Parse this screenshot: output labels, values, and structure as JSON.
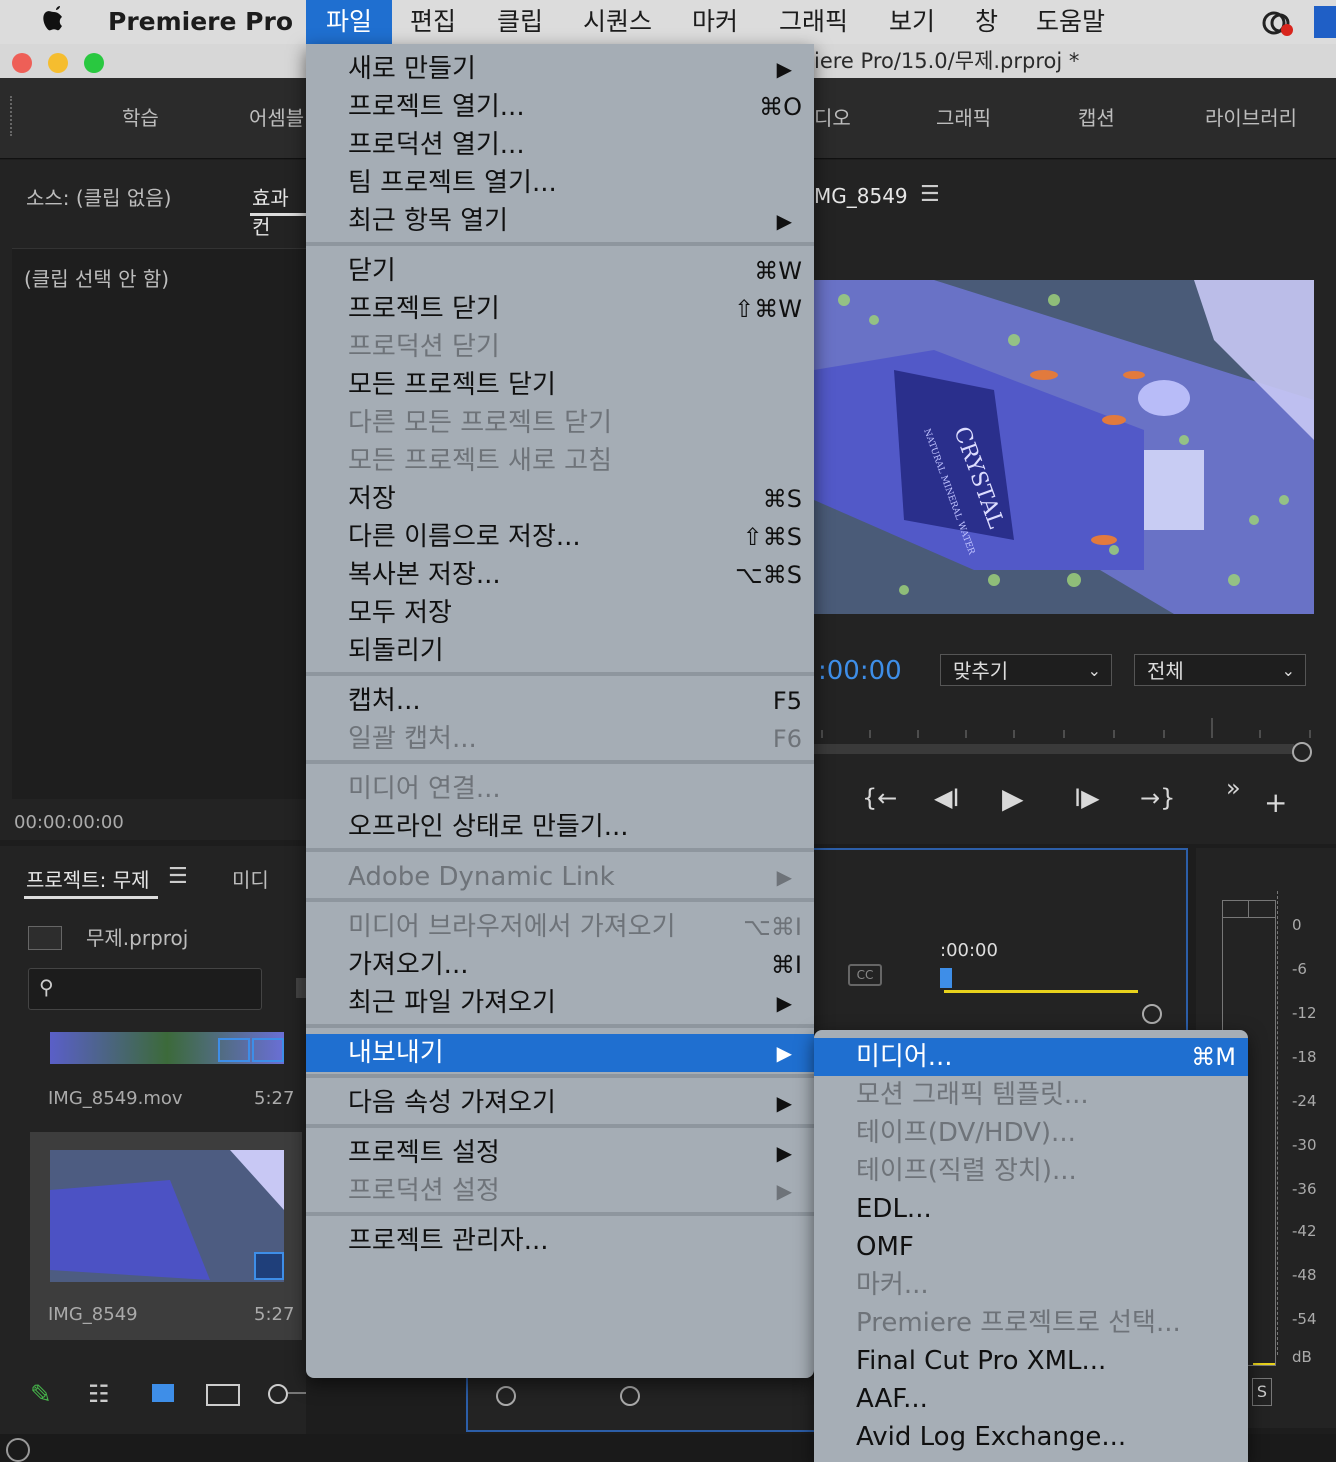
{
  "menubar": {
    "app_name": "Premiere Pro",
    "items": [
      "파일",
      "편집",
      "클립",
      "시퀀스",
      "마커",
      "그래픽",
      "보기",
      "창",
      "도움말"
    ]
  },
  "window": {
    "title": "iere Pro/15.0/무제.prproj *"
  },
  "workspaces": [
    "학습",
    "어셈블",
    "디오",
    "그래픽",
    "캡션",
    "라이브러리"
  ],
  "source_panel": {
    "tab_source": "소스: (클립 없음)",
    "tab_effects": "효과 컨",
    "no_clip": "(클립 선택 안 함)",
    "timecode": "00:00:00:00"
  },
  "program_monitor": {
    "sequence": "MG_8549",
    "timecode": ":00:00",
    "fit": "맞추기",
    "quality": "전체"
  },
  "project_panel": {
    "tab_project": "프로젝트: 무제",
    "tab_media": "미디",
    "file": "무제.prproj",
    "items": [
      {
        "name": "IMG_8549.mov",
        "duration": "5:27"
      },
      {
        "name": "IMG_8549",
        "duration": "5:27"
      }
    ]
  },
  "timeline": {
    "timecode": ":00:00"
  },
  "audio_meter": {
    "labels": [
      "0",
      "-6",
      "-12",
      "-18",
      "-24",
      "-30",
      "-36",
      "-42",
      "-48",
      "-54",
      "dB"
    ],
    "solo": "S"
  },
  "video_text": {
    "brand": "CRYSTAL",
    "sub": "NATURAL MINERAL WATER"
  },
  "file_menu": {
    "groups": [
      [
        {
          "label": "새로 만들기",
          "shortcut": "",
          "submenu": true,
          "disabled": false
        },
        {
          "label": "프로젝트 열기...",
          "shortcut": "⌘O",
          "submenu": false,
          "disabled": false
        },
        {
          "label": "프로덕션 열기...",
          "shortcut": "",
          "submenu": false,
          "disabled": false
        },
        {
          "label": "팀 프로젝트 열기...",
          "shortcut": "",
          "submenu": false,
          "disabled": false
        },
        {
          "label": "최근 항목 열기",
          "shortcut": "",
          "submenu": true,
          "disabled": false
        }
      ],
      [
        {
          "label": "닫기",
          "shortcut": "⌘W",
          "submenu": false,
          "disabled": false
        },
        {
          "label": "프로젝트 닫기",
          "shortcut": "⇧⌘W",
          "submenu": false,
          "disabled": false
        },
        {
          "label": "프로덕션 닫기",
          "shortcut": "",
          "submenu": false,
          "disabled": true
        },
        {
          "label": "모든 프로젝트 닫기",
          "shortcut": "",
          "submenu": false,
          "disabled": false
        },
        {
          "label": "다른 모든 프로젝트 닫기",
          "shortcut": "",
          "submenu": false,
          "disabled": true
        },
        {
          "label": "모든 프로젝트 새로 고침",
          "shortcut": "",
          "submenu": false,
          "disabled": true
        },
        {
          "label": "저장",
          "shortcut": "⌘S",
          "submenu": false,
          "disabled": false
        },
        {
          "label": "다른 이름으로 저장...",
          "shortcut": "⇧⌘S",
          "submenu": false,
          "disabled": false
        },
        {
          "label": "복사본 저장...",
          "shortcut": "⌥⌘S",
          "submenu": false,
          "disabled": false
        },
        {
          "label": "모두 저장",
          "shortcut": "",
          "submenu": false,
          "disabled": false
        },
        {
          "label": "되돌리기",
          "shortcut": "",
          "submenu": false,
          "disabled": false
        }
      ],
      [
        {
          "label": "캡처...",
          "shortcut": "F5",
          "submenu": false,
          "disabled": false
        },
        {
          "label": "일괄 캡처...",
          "shortcut": "F6",
          "submenu": false,
          "disabled": true
        }
      ],
      [
        {
          "label": "미디어 연결...",
          "shortcut": "",
          "submenu": false,
          "disabled": true
        },
        {
          "label": "오프라인 상태로 만들기...",
          "shortcut": "",
          "submenu": false,
          "disabled": false
        }
      ],
      [
        {
          "label": "Adobe Dynamic Link",
          "shortcut": "",
          "submenu": true,
          "disabled": true
        }
      ],
      [
        {
          "label": "미디어 브라우저에서 가져오기",
          "shortcut": "⌥⌘I",
          "submenu": false,
          "disabled": true
        },
        {
          "label": "가져오기...",
          "shortcut": "⌘I",
          "submenu": false,
          "disabled": false
        },
        {
          "label": "최근 파일 가져오기",
          "shortcut": "",
          "submenu": true,
          "disabled": false
        }
      ],
      [
        {
          "label": "내보내기",
          "shortcut": "",
          "submenu": true,
          "disabled": false,
          "highlighted": true
        }
      ],
      [
        {
          "label": "다음 속성 가져오기",
          "shortcut": "",
          "submenu": true,
          "disabled": false
        }
      ],
      [
        {
          "label": "프로젝트 설정",
          "shortcut": "",
          "submenu": true,
          "disabled": false
        },
        {
          "label": "프로덕션 설정",
          "shortcut": "",
          "submenu": true,
          "disabled": true
        }
      ],
      [
        {
          "label": "프로젝트 관리자...",
          "shortcut": "",
          "submenu": false,
          "disabled": false
        }
      ]
    ]
  },
  "export_menu": [
    {
      "label": "미디어...",
      "shortcut": "⌘M",
      "disabled": false,
      "highlighted": true
    },
    {
      "label": "모션 그래픽 템플릿...",
      "shortcut": "",
      "disabled": true
    },
    {
      "label": "테이프(DV/HDV)...",
      "shortcut": "",
      "disabled": true
    },
    {
      "label": "테이프(직렬 장치)...",
      "shortcut": "",
      "disabled": true
    },
    {
      "label": "EDL...",
      "shortcut": "",
      "disabled": false
    },
    {
      "label": "OMF",
      "shortcut": "",
      "disabled": false
    },
    {
      "label": "마커...",
      "shortcut": "",
      "disabled": true
    },
    {
      "label": "Premiere 프로젝트로 선택...",
      "shortcut": "",
      "disabled": true
    },
    {
      "label": "Final Cut Pro XML...",
      "shortcut": "",
      "disabled": false
    },
    {
      "label": "AAF...",
      "shortcut": "",
      "disabled": false
    },
    {
      "label": "Avid Log Exchange...",
      "shortcut": "",
      "disabled": false
    }
  ],
  "colors": {
    "accent": "#1f6fd0",
    "timecode_blue": "#3e8ee8",
    "in_out_yellow": "#e8d21c"
  }
}
